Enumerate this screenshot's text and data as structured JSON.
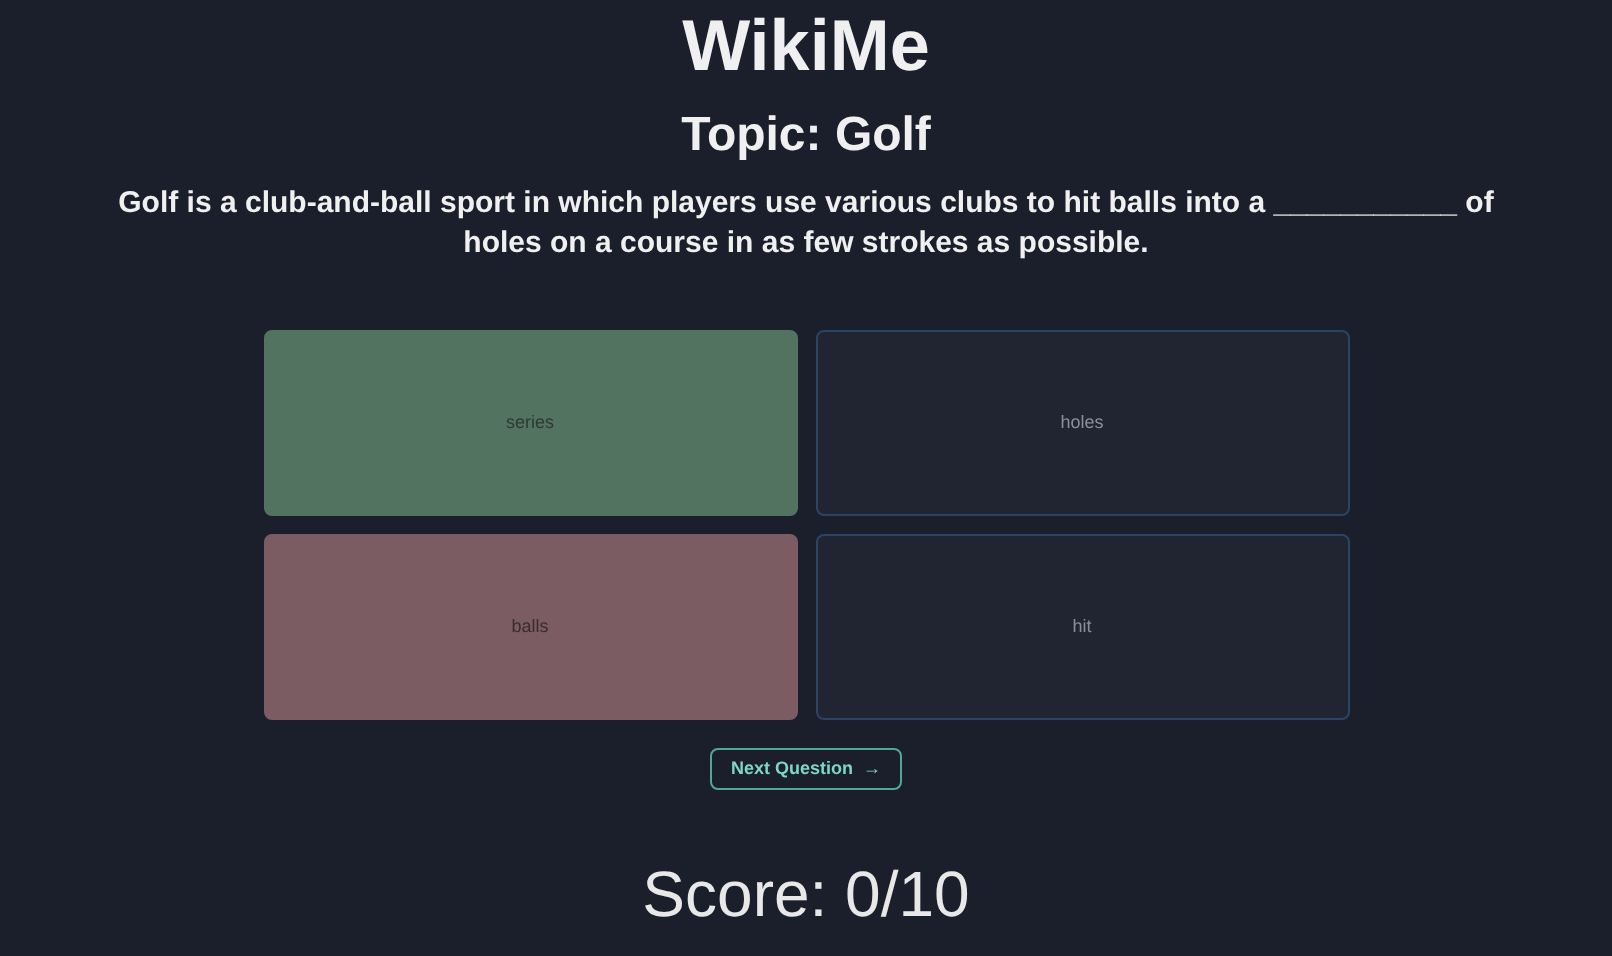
{
  "title": "WikiMe",
  "topic": "Topic: Golf",
  "question": "Golf is a club-and-ball sport in which players use various clubs to hit balls into a ___________ of holes on a course in as few strokes as possible.",
  "answers": [
    {
      "label": "series",
      "kind": "correct"
    },
    {
      "label": "holes",
      "kind": "neutral"
    },
    {
      "label": "balls",
      "kind": "wrong"
    },
    {
      "label": "hit",
      "kind": "neutral"
    }
  ],
  "next_button": {
    "label": "Next Question",
    "icon": "→"
  },
  "score": "Score: 0/10"
}
